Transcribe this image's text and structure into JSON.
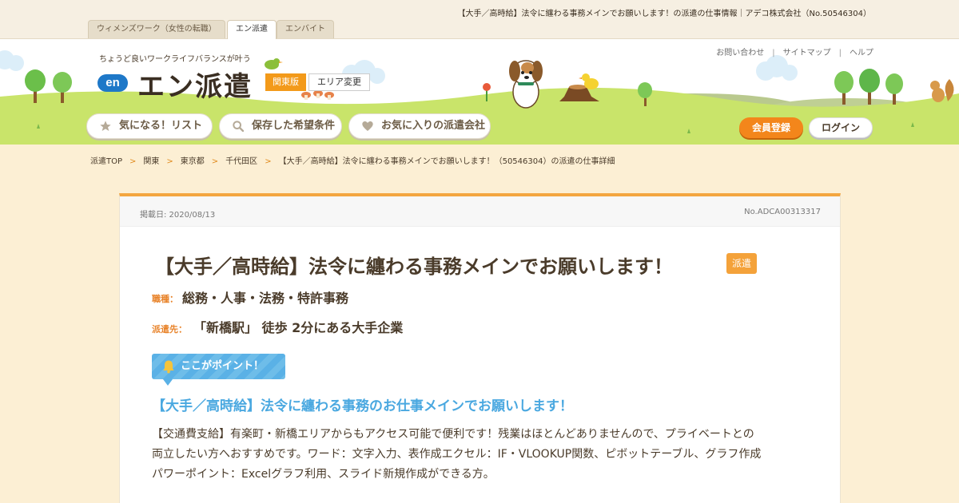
{
  "page_title": "【大手／高時給】法令に纏わる事務メインでお願いします！の派遣の仕事情報｜アデコ株式会社（No.50546304）",
  "site_tabs": [
    {
      "label": "ウィメンズワーク（女性の転職）",
      "active": false
    },
    {
      "label": "エン派遣",
      "active": true
    },
    {
      "label": "エンバイト",
      "active": false
    }
  ],
  "header": {
    "tagline": "ちょうど良いワークライフバランスが叶う",
    "logo_mark": "en",
    "logo_text": "エン派遣",
    "region_badge": "関東版",
    "area_change": "エリア変更",
    "util_links": [
      "お問い合わせ",
      "サイトマップ",
      "ヘルプ"
    ]
  },
  "nav": {
    "favorites_list": "気になる！リスト",
    "saved_conditions": "保存した希望条件",
    "favorite_companies": "お気に入りの派遣会社",
    "register": "会員登録",
    "login": "ログイン"
  },
  "breadcrumb": [
    "派遣TOP",
    "関東",
    "東京都",
    "千代田区",
    "【大手／高時給】法令に纏わる事務メインでお願いします！（50546304）の派遣の仕事詳細"
  ],
  "job": {
    "posted_date": "掲載日: 2020/08/13",
    "job_no": "No.ADCA00313317",
    "title": "【大手／高時給】法令に纏わる事務メインでお願いします！",
    "type_badge": "派遣",
    "category_label": "職種：",
    "category_value": "総務・人事・法務・特許事務",
    "destination_label": "派遣先：",
    "destination_value": "「新橋駅」 徒歩 2分にある大手企業",
    "point_badge": "ここがポイント！",
    "point_title": "【大手／高時給】法令に纏わる事務のお仕事メインでお願いします！",
    "point_lines": [
      "【交通費支給】有楽町・新橋エリアからもアクセス可能で便利です！残業はほとんどありませんので、プライベートとの",
      "両立したい方へおすすめです。ワード：文字入力、表作成エクセル：IF・VLOOKUP関数、ピボットテーブル、グラフ作成",
      "パワーポイント：Excelグラフ利用、スライド新規作成ができる方。"
    ]
  },
  "colors": {
    "accent_orange": "#f3a640",
    "badge_blue": "#5ab1e6",
    "page_bg": "#fcefd4",
    "grass": "#c9e46a"
  }
}
